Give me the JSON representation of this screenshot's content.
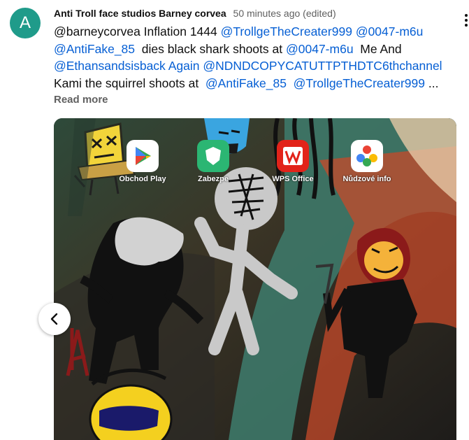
{
  "comment": {
    "avatar_letter": "A",
    "author": "Anti Troll face studios Barney corvea",
    "timestamp": "50 minutes ago (edited)",
    "text_lines": [
      [
        {
          "t": "@barneycorvea Inflation 1444 ",
          "m": false
        },
        {
          "t": "@TrollgeTheCreater999",
          "m": true
        },
        {
          "t": " ",
          "m": false
        },
        {
          "t": "@0047-m6u",
          "m": true
        }
      ],
      [
        {
          "t": "@AntiFake_85",
          "m": true
        },
        {
          "t": "  dies black shark shoots at ",
          "m": false
        },
        {
          "t": "@0047-m6u",
          "m": true
        },
        {
          "t": "  Me And",
          "m": false
        }
      ],
      [
        {
          "t": "@Ethansandsisback Again",
          "m": true
        },
        {
          "t": " ",
          "m": false
        },
        {
          "t": "@NDNDCOPYCATUTTPTHDTC6thchannel",
          "m": true
        }
      ],
      [
        {
          "t": "Kami the squirrel shoots at  ",
          "m": false
        },
        {
          "t": "@AntiFake_85",
          "m": true
        },
        {
          "t": "  ",
          "m": false
        },
        {
          "t": "@TrollgeTheCreater999",
          "m": true
        },
        {
          "t": " ...",
          "m": false
        }
      ]
    ],
    "read_more": "Read more"
  },
  "image": {
    "apps": [
      {
        "label": "Obchod Play",
        "icon": "play-store-icon"
      },
      {
        "label": "Zabezpe",
        "icon": "security-icon"
      },
      {
        "label": "WPS Office",
        "icon": "wps-office-icon"
      },
      {
        "label": "Nůdzové info",
        "icon": "emergency-info-icon"
      }
    ],
    "drawn_characters": [
      {
        "glyph": "xx",
        "name": "sponge-character"
      },
      {
        "glyph": "7",
        "name": "number-seven-mark"
      },
      {
        "glyph": "A",
        "name": "letter-a-mark"
      }
    ]
  },
  "carousel": {
    "prev_icon": "chevron-left-icon"
  },
  "colors": {
    "avatar": "#1f9b8a",
    "mention": "#065fd4",
    "muted": "#606060"
  }
}
